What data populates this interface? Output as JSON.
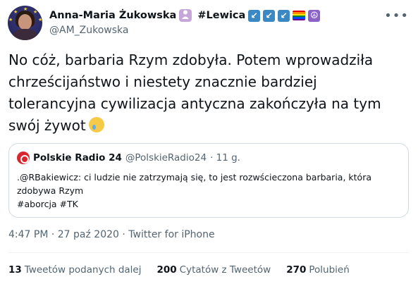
{
  "author": {
    "display_name": "Anna-Maria Żukowska",
    "hashtag": "#Lewica",
    "handle": "@AM_Zukowska",
    "badge_icons": [
      "arrow-down-left-icon",
      "arrow-down-left-icon",
      "arrow-down-left-icon",
      "rainbow-flag-icon",
      "peace-symbol-icon"
    ],
    "badge_glyphs": [
      "↙",
      "↙",
      "↙",
      "☮"
    ],
    "badge_color": "#3b88c3"
  },
  "tweet": {
    "lines": [
      "No cóż, barbaria Rzym zdobyła. Potem wprowadziła",
      "chrześcijaństwo i niestety znacznie bardziej",
      "tolerancyjna cywilizacja antyczna zakończyła na tym",
      "swój żywot"
    ],
    "emoji": "crying-face-icon"
  },
  "quote": {
    "name": "Polskie Radio 24",
    "handle": "@PolskieRadio24",
    "time": "· 11 g.",
    "lines": [
      ".@RBakiewicz:  ci ludzie nie zatrzymają się, to jest  rozwścieczona barbaria, która",
      "zdobywa Rzym",
      "#aborcja #TK"
    ],
    "logo_color": "#d8262f"
  },
  "timestamp": "4:47 PM · 27 paź 2020 · Twitter for iPhone",
  "stats": {
    "retweets_count": "13",
    "retweets_label": "Tweetów podanych dalej",
    "quotes_count": "200",
    "quotes_label": "Cytatów z Tweetów",
    "likes_count": "270",
    "likes_label": "Polubień"
  },
  "more_label": "•••",
  "colors": {
    "text": "#0f1419",
    "muted": "#536471",
    "border": "#cfd9de"
  }
}
